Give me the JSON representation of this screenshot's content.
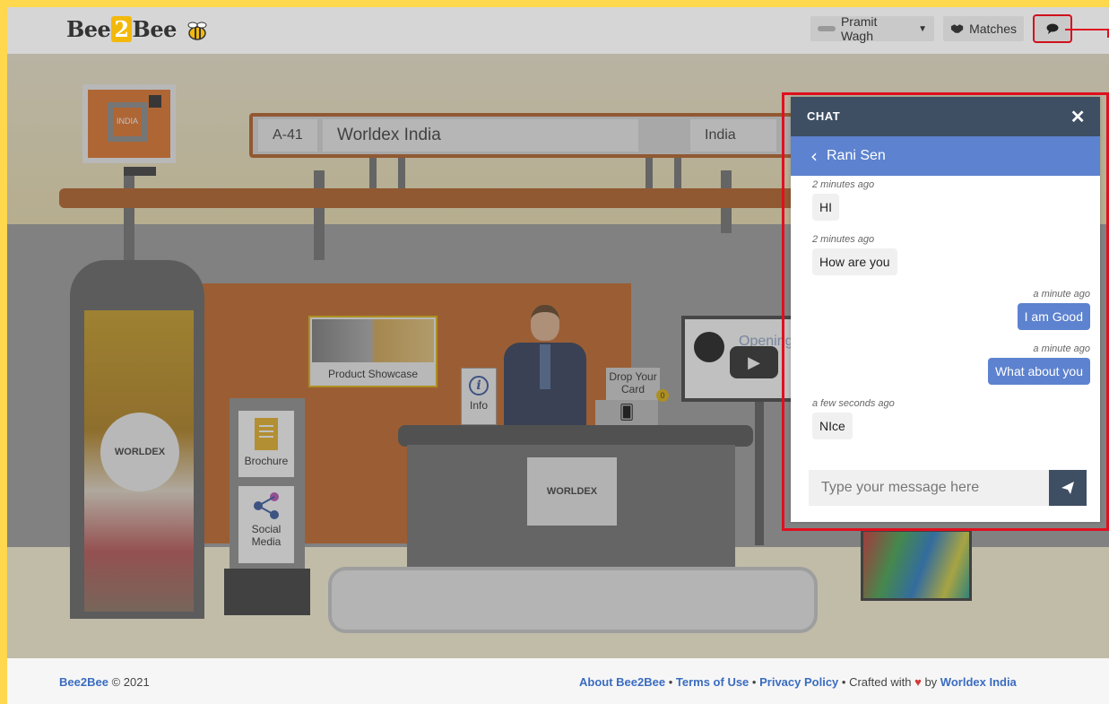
{
  "navbar": {
    "brand": {
      "prefix": "Bee",
      "two": "2",
      "suffix": "Bee"
    },
    "user_name": "Pramit Wagh",
    "matches_label": "Matches",
    "icons": {
      "user_caret": "chevron-down-icon",
      "matches": "handshake-icon",
      "chat": "chat-bubble-icon"
    }
  },
  "booth": {
    "stall_id": "A-41",
    "company_name": "Worldex India",
    "country": "India",
    "logo_text": "INDIA",
    "banner_logo_text": "WORLDEX",
    "counter_logo_text": "WORLDEX",
    "showcase_label": "Product Showcase",
    "info_label": "Info",
    "drop_card_label": "Drop Your Card",
    "drop_card_count": "0",
    "brochure_label": "Brochure",
    "social_media_label": "Social Media",
    "video_title": "Opening C"
  },
  "chat": {
    "title": "CHAT",
    "contact_name": "Rani Sen",
    "messages": [
      {
        "direction": "in",
        "time": "2 minutes ago",
        "text": "HI"
      },
      {
        "direction": "in",
        "time": "2 minutes ago",
        "text": "How are you"
      },
      {
        "direction": "out",
        "time": "a minute ago",
        "text": "I am Good"
      },
      {
        "direction": "out",
        "time": "a minute ago",
        "text": "What about you"
      },
      {
        "direction": "in",
        "time": "a few seconds ago",
        "text": "NIce"
      }
    ],
    "input_placeholder": "Type your message here"
  },
  "footer": {
    "brand": "Bee2Bee",
    "copyright": "© 2021",
    "links": {
      "about": "About Bee2Bee",
      "terms": "Terms of Use",
      "privacy": "Privacy Policy",
      "company": "Worldex India"
    },
    "crafted_with": "Crafted with",
    "by": "by",
    "separator": "•"
  },
  "colors": {
    "frame_yellow": "#ffd84d",
    "chat_header": "#3e4e63",
    "chat_accent": "#5d82cf",
    "highlight_red": "#e01020",
    "booth_orange": "#c3621e"
  }
}
